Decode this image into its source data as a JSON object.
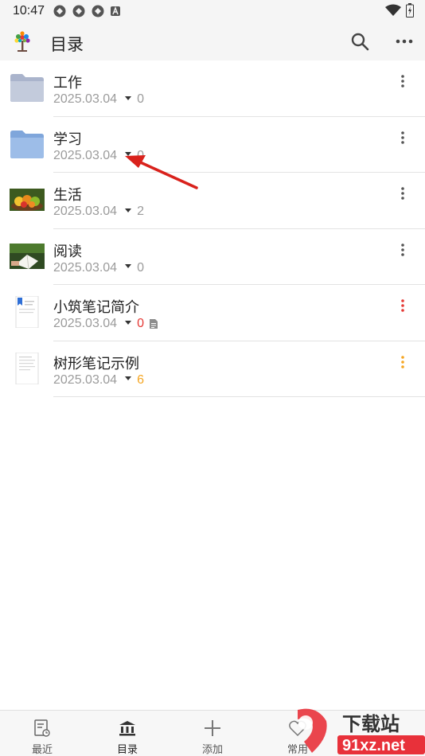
{
  "status": {
    "time": "10:47"
  },
  "app_bar": {
    "title": "目录",
    "search_icon": "search-icon",
    "more_icon": "more-horizontal-icon"
  },
  "items": [
    {
      "name": "工作",
      "date": "2025.03.04",
      "count": "0",
      "count_color": "#9b9b9b",
      "thumb": "folder-gray",
      "kebab_color": "#555555",
      "has_doc_icon": false
    },
    {
      "name": "学习",
      "date": "2025.03.04",
      "count": "0",
      "count_color": "#9b9b9b",
      "thumb": "folder-blue",
      "kebab_color": "#555555",
      "has_doc_icon": false
    },
    {
      "name": "生活",
      "date": "2025.03.04",
      "count": "2",
      "count_color": "#9b9b9b",
      "thumb": "fruit-photo",
      "kebab_color": "#555555",
      "has_doc_icon": false
    },
    {
      "name": "阅读",
      "date": "2025.03.04",
      "count": "0",
      "count_color": "#9b9b9b",
      "thumb": "reading-photo",
      "kebab_color": "#555555",
      "has_doc_icon": false
    },
    {
      "name": "小筑笔记简介",
      "date": "2025.03.04",
      "count": "0",
      "count_color": "#e53935",
      "thumb": "document-bookmark",
      "kebab_color": "#e53935",
      "has_doc_icon": true
    },
    {
      "name": "树形笔记示例",
      "date": "2025.03.04",
      "count": "6",
      "count_color": "#f5a623",
      "thumb": "document-plain",
      "kebab_color": "#f5a623",
      "has_doc_icon": false
    }
  ],
  "bottom_nav": [
    {
      "label": "最近",
      "icon": "recent-note-icon"
    },
    {
      "label": "目录",
      "icon": "library-icon"
    },
    {
      "label": "添加",
      "icon": "plus-icon"
    },
    {
      "label": "常用",
      "icon": "favorite-icon"
    }
  ],
  "watermark": {
    "text1": "下载站",
    "text2": "91xz.net"
  }
}
